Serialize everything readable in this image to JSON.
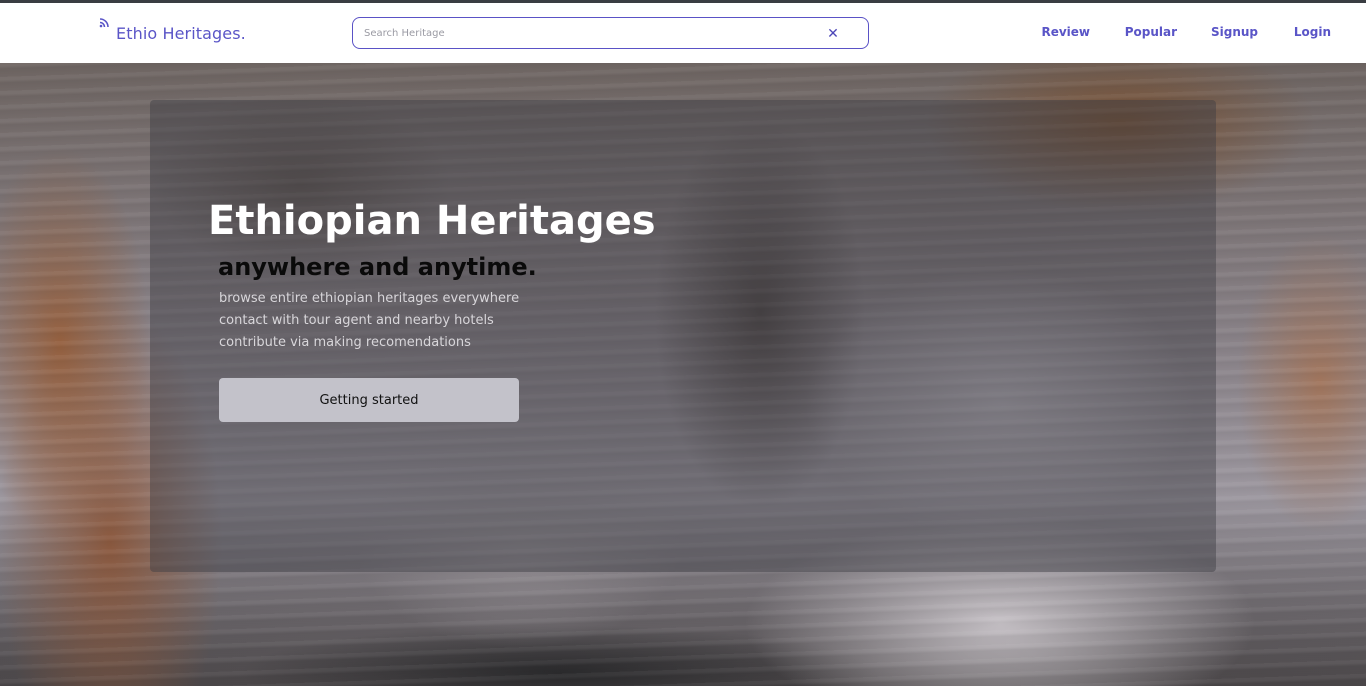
{
  "navbar": {
    "brand": "Ethio Heritages.",
    "brand_icon": "wifi-signal-icon",
    "accent_color": "#5a55c7",
    "search": {
      "placeholder": "Search Heritage",
      "value": "",
      "clear_label": "✕"
    },
    "links": [
      {
        "label": "Review"
      },
      {
        "label": "Popular"
      },
      {
        "label": "Signup"
      },
      {
        "label": "Login"
      }
    ]
  },
  "hero": {
    "title": "Ethiopian Heritages",
    "subtitle": "anywhere and anytime.",
    "lines": [
      "browse entire ethiopian heritages everywhere",
      "contact with tour agent and nearby hotels",
      "contribute via making recomendations"
    ],
    "cta_label": "Getting started"
  }
}
